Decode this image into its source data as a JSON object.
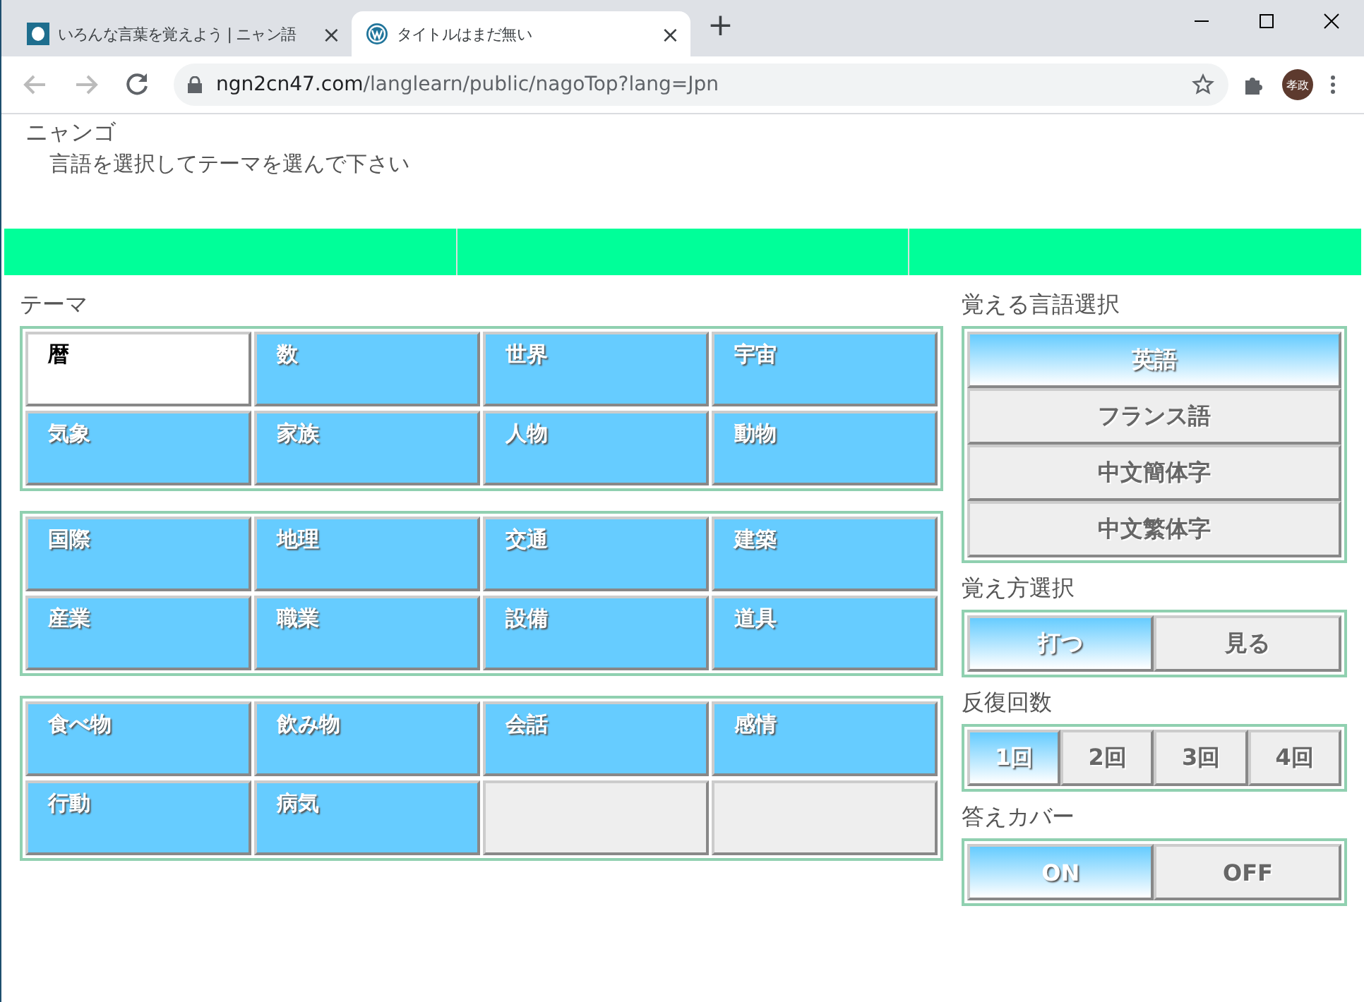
{
  "browser": {
    "tabs": [
      {
        "title": "いろんな言葉を覚えよう | ニャン語",
        "selected": false
      },
      {
        "title": "タイトルはまだ無い",
        "selected": true
      }
    ],
    "close_glyph": "×",
    "new_tab": "+",
    "url_host": "ngn2cn47.com",
    "url_path": "/langlearn/public/nagoTop?lang=Jpn",
    "avatar": "孝政"
  },
  "page": {
    "site_title": "ニャンゴ",
    "instruction": "言語を選択してテーマを選んで下さい",
    "theme_label": "テーマ",
    "theme_groups": [
      [
        {
          "kind": "theme",
          "label": "暦",
          "selected": true
        },
        {
          "kind": "theme",
          "label": "数",
          "selected": false
        },
        {
          "kind": "theme",
          "label": "世界",
          "selected": false
        },
        {
          "kind": "theme",
          "label": "宇宙",
          "selected": false
        },
        {
          "kind": "theme",
          "label": "気象",
          "selected": false
        },
        {
          "kind": "theme",
          "label": "家族",
          "selected": false
        },
        {
          "kind": "theme",
          "label": "人物",
          "selected": false
        },
        {
          "kind": "theme",
          "label": "動物",
          "selected": false
        }
      ],
      [
        {
          "kind": "theme",
          "label": "国際",
          "selected": false
        },
        {
          "kind": "theme",
          "label": "地理",
          "selected": false
        },
        {
          "kind": "theme",
          "label": "交通",
          "selected": false
        },
        {
          "kind": "theme",
          "label": "建築",
          "selected": false
        },
        {
          "kind": "theme",
          "label": "産業",
          "selected": false
        },
        {
          "kind": "theme",
          "label": "職業",
          "selected": false
        },
        {
          "kind": "theme",
          "label": "設備",
          "selected": false
        },
        {
          "kind": "theme",
          "label": "道具",
          "selected": false
        }
      ],
      [
        {
          "kind": "theme",
          "label": "食べ物",
          "selected": false
        },
        {
          "kind": "theme",
          "label": "飲み物",
          "selected": false
        },
        {
          "kind": "theme",
          "label": "会話",
          "selected": false
        },
        {
          "kind": "theme",
          "label": "感情",
          "selected": false
        },
        {
          "kind": "theme",
          "label": "行動",
          "selected": false
        },
        {
          "kind": "theme",
          "label": "病気",
          "selected": false
        },
        {
          "kind": "blank"
        },
        {
          "kind": "blank"
        }
      ]
    ],
    "option_groups": [
      {
        "label": "覚える言語選択",
        "kind": "stack",
        "options": [
          {
            "label": "英語",
            "selected": true
          },
          {
            "label": "フランス語",
            "selected": false
          },
          {
            "label": "中文簡体字",
            "selected": false
          },
          {
            "label": "中文繁体字",
            "selected": false
          }
        ]
      },
      {
        "label": "覚え方選択",
        "kind": "row",
        "options": [
          {
            "label": "打つ",
            "selected": true
          },
          {
            "label": "見る",
            "selected": false
          }
        ]
      },
      {
        "label": "反復回数",
        "kind": "row",
        "options": [
          {
            "label": "1回",
            "selected": true
          },
          {
            "label": "2回",
            "selected": false
          },
          {
            "label": "3回",
            "selected": false
          },
          {
            "label": "4回",
            "selected": false
          }
        ]
      },
      {
        "label": "答えカバー",
        "kind": "row",
        "options": [
          {
            "label": "ON",
            "selected": true
          },
          {
            "label": "OFF",
            "selected": false
          }
        ]
      }
    ]
  }
}
